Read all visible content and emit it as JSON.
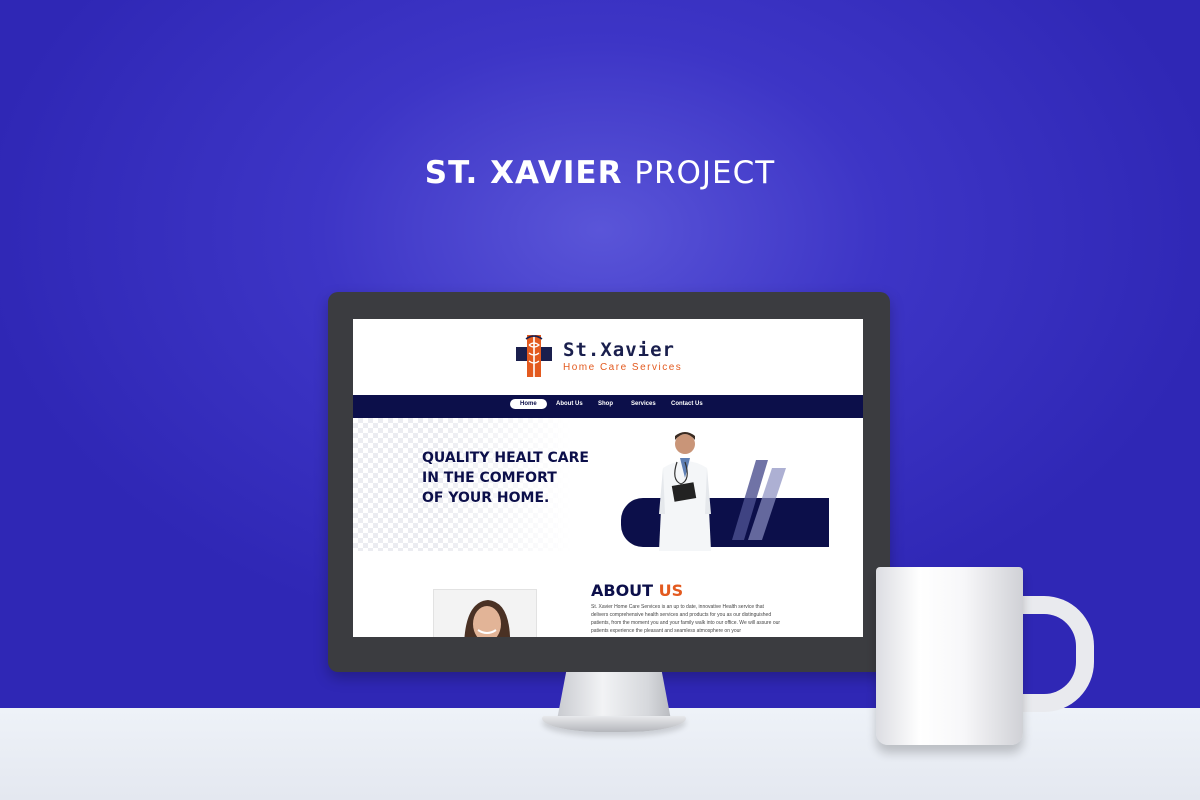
{
  "headline": {
    "bold": "ST. XAVIER",
    "light": "PROJECT"
  },
  "site": {
    "logo": {
      "name": "St.Xavier",
      "tagline": "Home Care Services",
      "icon": "medical-cross-caduceus-icon"
    },
    "nav": {
      "items": [
        "Home",
        "About Us",
        "Shop",
        "Services",
        "Contact Us"
      ],
      "active": "Home"
    },
    "hero": {
      "lines": [
        "QUALITY HEALT CARE",
        "IN THE COMFORT",
        "OF YOUR HOME."
      ]
    },
    "about": {
      "title_main": "ABOUT",
      "title_accent": "US",
      "body": "St. Xavier Home Care Services is an up to date, innovative Health service that delivers comprehensive health services and products for you as our distinguished patients, from the moment you and your family walk into our office. We will assure our patients experience the pleasant and seamless atmosphere on your"
    }
  },
  "colors": {
    "background": "#3d35c6",
    "navy": "#0c0f4a",
    "accent": "#e35a1f"
  }
}
